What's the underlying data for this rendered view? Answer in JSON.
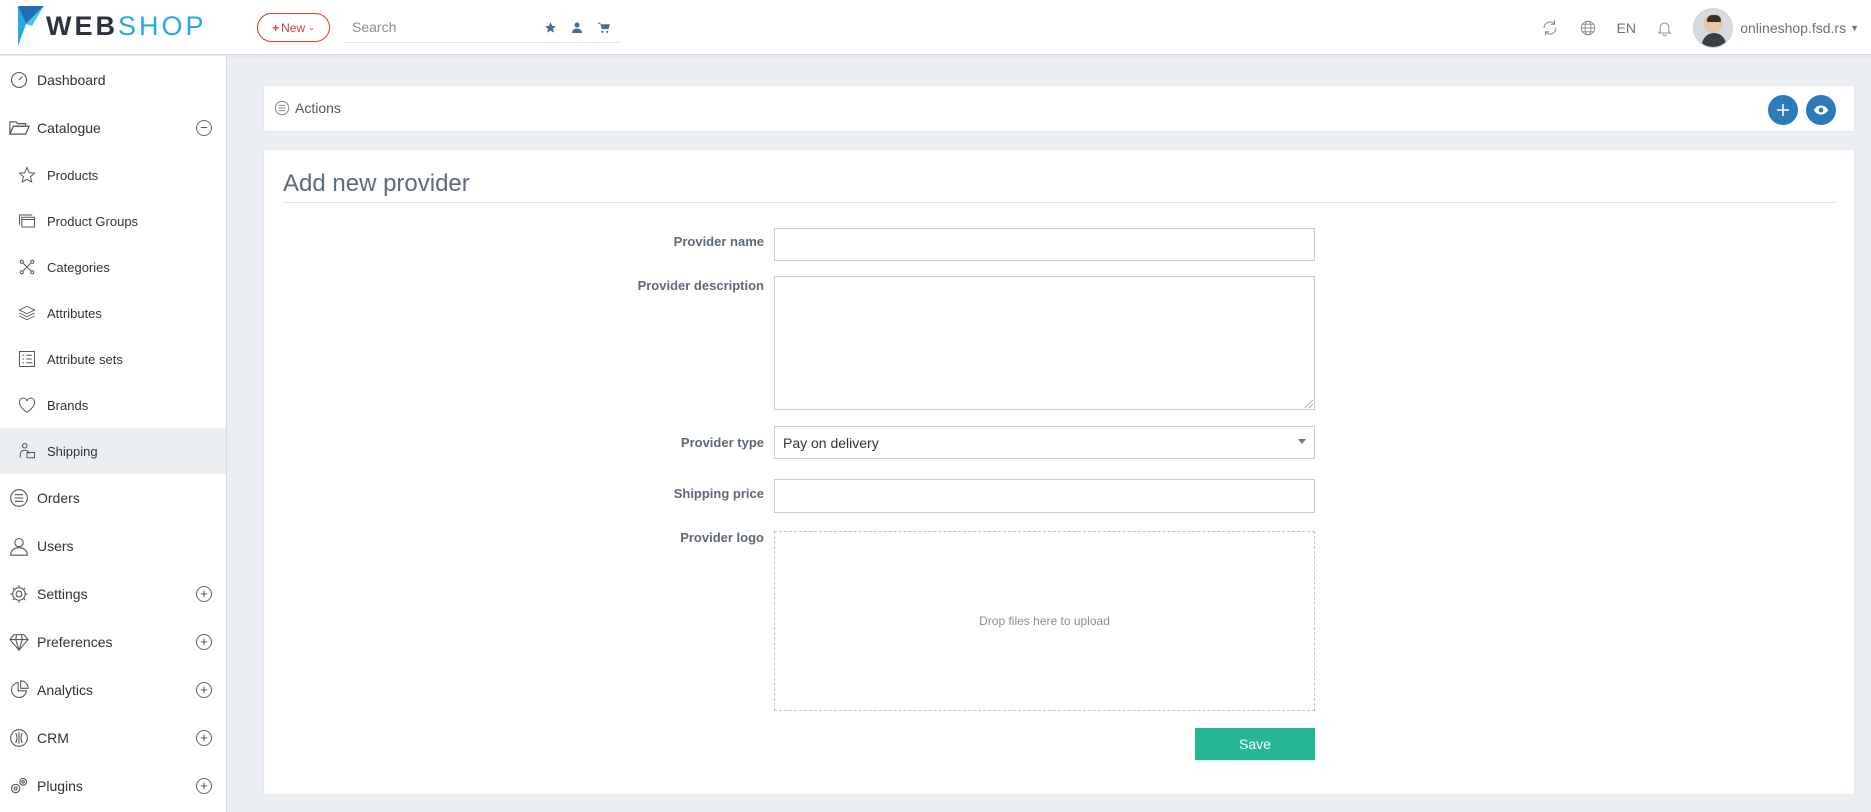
{
  "brand": {
    "part1": "WEB",
    "part2": "SHOP"
  },
  "topbar": {
    "new_label": "New",
    "search_placeholder": "Search",
    "language": "EN",
    "user_name": "onlineshop.fsd.rs"
  },
  "sidebar": {
    "dashboard": "Dashboard",
    "catalogue": "Catalogue",
    "catalogue_items": {
      "products": "Products",
      "product_groups": "Product Groups",
      "categories": "Categories",
      "attributes": "Attributes",
      "attribute_sets": "Attribute sets",
      "brands": "Brands",
      "shipping": "Shipping"
    },
    "orders": "Orders",
    "users": "Users",
    "settings": "Settings",
    "preferences": "Preferences",
    "analytics": "Analytics",
    "crm": "CRM",
    "plugins": "Plugins",
    "active_item": "Shipping"
  },
  "actions": {
    "label": "Actions"
  },
  "form": {
    "title": "Add new provider",
    "provider_name_label": "Provider name",
    "provider_name_value": "",
    "provider_description_label": "Provider description",
    "provider_description_value": "",
    "provider_type_label": "Provider type",
    "provider_type_value": "Pay on delivery",
    "shipping_price_label": "Shipping price",
    "shipping_price_value": "",
    "provider_logo_label": "Provider logo",
    "dropzone_text": "Drop files here to upload",
    "save_label": "Save"
  },
  "colors": {
    "accent_blue": "#2a7bb8",
    "logo_blue": "#29a9e1",
    "new_red": "#e03a3a",
    "save_green": "#26b797"
  }
}
